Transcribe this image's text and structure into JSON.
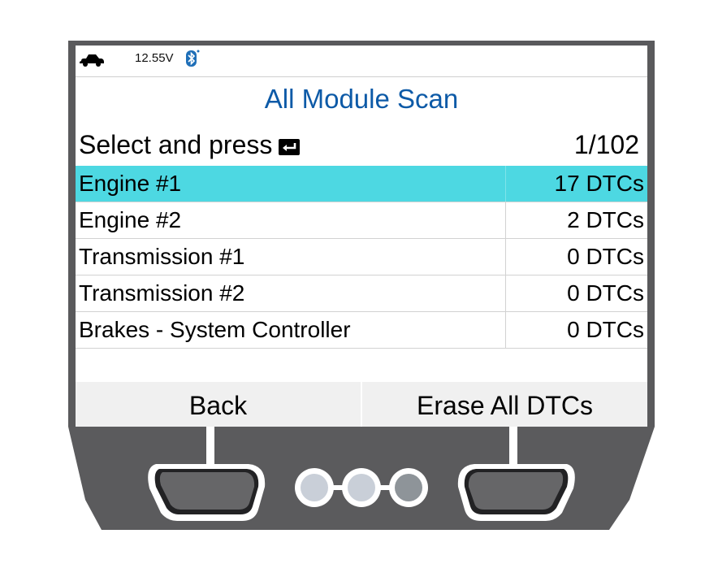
{
  "status_bar": {
    "vehicle_icon": "car-icon",
    "voltage": "12.55V",
    "bluetooth_icon": "bluetooth-icon"
  },
  "screen": {
    "title": "All Module Scan",
    "instruction": "Select and press",
    "enter_icon": "enter-key-icon",
    "page_indicator": "1/102"
  },
  "modules": [
    {
      "name": "Engine #1",
      "dtcs": "17 DTCs",
      "selected": true
    },
    {
      "name": "Engine #2",
      "dtcs": "2 DTCs",
      "selected": false
    },
    {
      "name": "Transmission #1",
      "dtcs": "0 DTCs",
      "selected": false
    },
    {
      "name": "Transmission #2",
      "dtcs": "0 DTCs",
      "selected": false
    },
    {
      "name": "Brakes - System Controller",
      "dtcs": "0 DTCs",
      "selected": false
    }
  ],
  "softkeys": {
    "left": "Back",
    "right": "Erase All DTCs"
  },
  "colors": {
    "title": "#0d5aa7",
    "selected_row": "#4dd8e2",
    "device_body": "#5a5a5c"
  }
}
